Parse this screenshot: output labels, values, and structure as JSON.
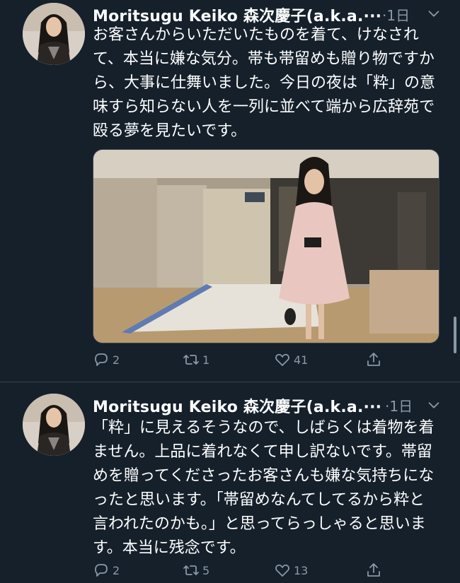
{
  "tweets": [
    {
      "author": "Moritsugu Keiko 森次慶子(a.k.a.···",
      "time": "·1日",
      "text": "お客さんからいただいたものを着て、けなされて、本当に嫌な気分。帯も帯留めも贈り物ですから、大事に仕舞いました。今日の夜は「粋」の意味すら知らない人を一列に並べて端から広辞苑で殴る夢を見たいです。",
      "replies": "2",
      "retweets": "1",
      "likes": "41"
    },
    {
      "author": "Moritsugu Keiko 森次慶子(a.k.a.···",
      "time": "·1日",
      "text": "「粋」に見えるそうなので、しばらくは着物を着ません。上品に着れなくて申し訳ないです。帯留めを贈ってくださったお客さんも嫌な気持ちになったと思います。「帯留めなんてしてるから粋と言われたのかも。」と思ってらっしゃると思います。本当に残念です。",
      "replies": "2",
      "retweets": "5",
      "likes": "13"
    }
  ],
  "icons": {
    "reply": "reply-icon",
    "retweet": "retweet-icon",
    "like": "heart-icon",
    "share": "share-icon",
    "more": "chevron-down-icon"
  },
  "colors": {
    "background": "#15202b",
    "text": "#ffffff",
    "secondary": "#8899a6",
    "divider": "#38444d"
  }
}
